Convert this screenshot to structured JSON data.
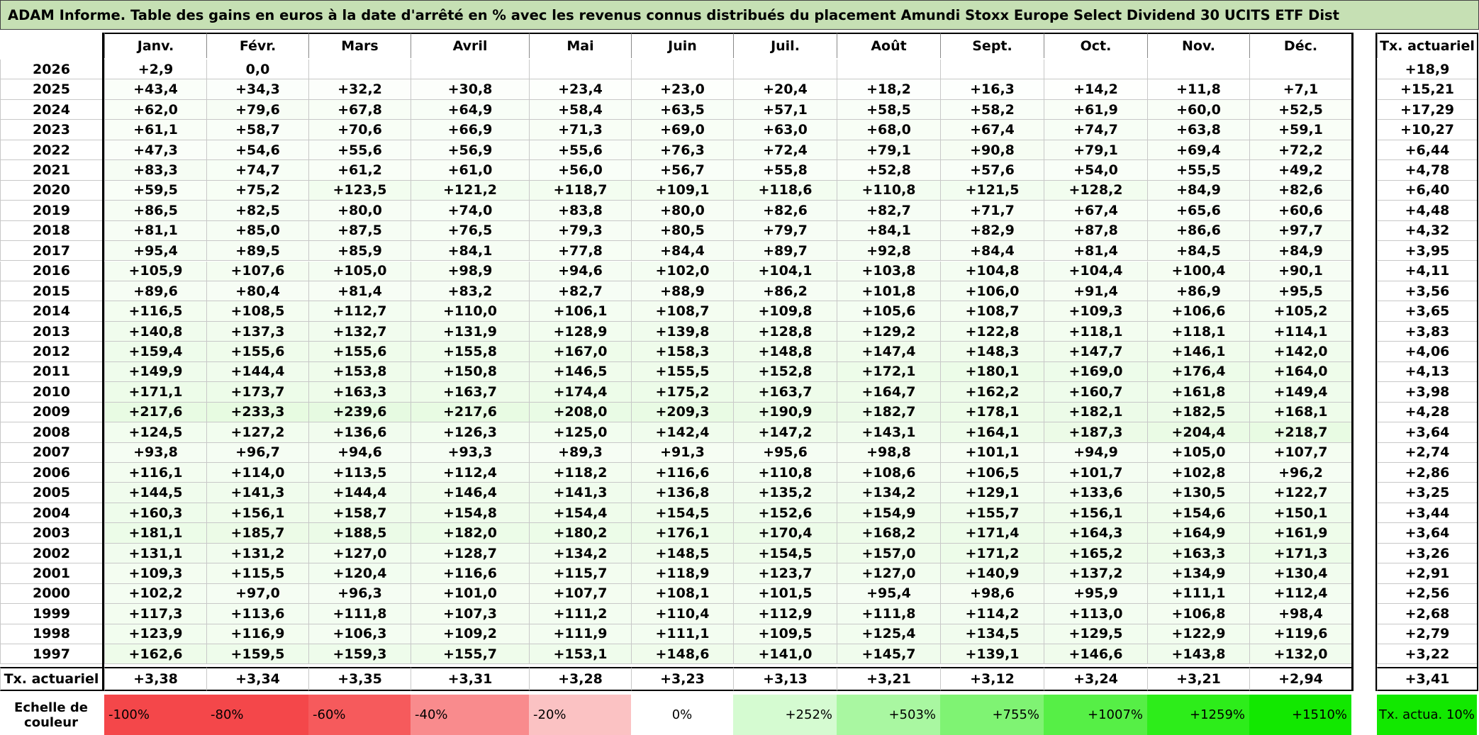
{
  "title": "ADAM Informe. Table des gains en euros à la date d'arrêté en % avec les revenus connus distribués du placement Amundi Stoxx Europe Select Dividend 30 UCITS ETF Dist",
  "months": [
    "Janv.",
    "Févr.",
    "Mars",
    "Avril",
    "Mai",
    "Juin",
    "Juil.",
    "Août",
    "Sept.",
    "Oct.",
    "Nov.",
    "Déc."
  ],
  "actuarial_header": "Tx. actuariel",
  "rows": [
    {
      "year": "2026",
      "values": [
        "+2,9",
        "0,0",
        "",
        "",
        "",
        "",
        "",
        "",
        "",
        "",
        "",
        ""
      ],
      "rate": "+18,9"
    },
    {
      "year": "2025",
      "values": [
        "+43,4",
        "+34,3",
        "+32,2",
        "+30,8",
        "+23,4",
        "+23,0",
        "+20,4",
        "+18,2",
        "+16,3",
        "+14,2",
        "+11,8",
        "+7,1"
      ],
      "rate": "+15,21"
    },
    {
      "year": "2024",
      "values": [
        "+62,0",
        "+79,6",
        "+67,8",
        "+64,9",
        "+58,4",
        "+63,5",
        "+57,1",
        "+58,5",
        "+58,2",
        "+61,9",
        "+60,0",
        "+52,5"
      ],
      "rate": "+17,29"
    },
    {
      "year": "2023",
      "values": [
        "+61,1",
        "+58,7",
        "+70,6",
        "+66,9",
        "+71,3",
        "+69,0",
        "+63,0",
        "+68,0",
        "+67,4",
        "+74,7",
        "+63,8",
        "+59,1"
      ],
      "rate": "+10,27"
    },
    {
      "year": "2022",
      "values": [
        "+47,3",
        "+54,6",
        "+55,6",
        "+56,9",
        "+55,6",
        "+76,3",
        "+72,4",
        "+79,1",
        "+90,8",
        "+79,1",
        "+69,4",
        "+72,2"
      ],
      "rate": "+6,44"
    },
    {
      "year": "2021",
      "values": [
        "+83,3",
        "+74,7",
        "+61,2",
        "+61,0",
        "+56,0",
        "+56,7",
        "+55,8",
        "+52,8",
        "+57,6",
        "+54,0",
        "+55,5",
        "+49,2"
      ],
      "rate": "+4,78"
    },
    {
      "year": "2020",
      "values": [
        "+59,5",
        "+75,2",
        "+123,5",
        "+121,2",
        "+118,7",
        "+109,1",
        "+118,6",
        "+110,8",
        "+121,5",
        "+128,2",
        "+84,9",
        "+82,6"
      ],
      "rate": "+6,40"
    },
    {
      "year": "2019",
      "values": [
        "+86,5",
        "+82,5",
        "+80,0",
        "+74,0",
        "+83,8",
        "+80,0",
        "+82,6",
        "+82,7",
        "+71,7",
        "+67,4",
        "+65,6",
        "+60,6"
      ],
      "rate": "+4,48"
    },
    {
      "year": "2018",
      "values": [
        "+81,1",
        "+85,0",
        "+87,5",
        "+76,5",
        "+79,3",
        "+80,5",
        "+79,7",
        "+84,1",
        "+82,9",
        "+87,8",
        "+86,6",
        "+97,7"
      ],
      "rate": "+4,32"
    },
    {
      "year": "2017",
      "values": [
        "+95,4",
        "+89,5",
        "+85,9",
        "+84,1",
        "+77,8",
        "+84,4",
        "+89,7",
        "+92,8",
        "+84,4",
        "+81,4",
        "+84,5",
        "+84,9"
      ],
      "rate": "+3,95"
    },
    {
      "year": "2016",
      "values": [
        "+105,9",
        "+107,6",
        "+105,0",
        "+98,9",
        "+94,6",
        "+102,0",
        "+104,1",
        "+103,8",
        "+104,8",
        "+104,4",
        "+100,4",
        "+90,1"
      ],
      "rate": "+4,11"
    },
    {
      "year": "2015",
      "values": [
        "+89,6",
        "+80,4",
        "+81,4",
        "+83,2",
        "+82,7",
        "+88,9",
        "+86,2",
        "+101,8",
        "+106,0",
        "+91,4",
        "+86,9",
        "+95,5"
      ],
      "rate": "+3,56"
    },
    {
      "year": "2014",
      "values": [
        "+116,5",
        "+108,5",
        "+112,7",
        "+110,0",
        "+106,1",
        "+108,7",
        "+109,8",
        "+105,6",
        "+108,7",
        "+109,3",
        "+106,6",
        "+105,2"
      ],
      "rate": "+3,65"
    },
    {
      "year": "2013",
      "values": [
        "+140,8",
        "+137,3",
        "+132,7",
        "+131,9",
        "+128,9",
        "+139,8",
        "+128,8",
        "+129,2",
        "+122,8",
        "+118,1",
        "+118,1",
        "+114,1"
      ],
      "rate": "+3,83"
    },
    {
      "year": "2012",
      "values": [
        "+159,4",
        "+155,6",
        "+155,6",
        "+155,8",
        "+167,0",
        "+158,3",
        "+148,8",
        "+147,4",
        "+148,3",
        "+147,7",
        "+146,1",
        "+142,0"
      ],
      "rate": "+4,06"
    },
    {
      "year": "2011",
      "values": [
        "+149,9",
        "+144,4",
        "+153,8",
        "+150,8",
        "+146,5",
        "+155,5",
        "+152,8",
        "+172,1",
        "+180,1",
        "+169,0",
        "+176,4",
        "+164,0"
      ],
      "rate": "+4,13"
    },
    {
      "year": "2010",
      "values": [
        "+171,1",
        "+173,7",
        "+163,3",
        "+163,7",
        "+174,4",
        "+175,2",
        "+163,7",
        "+164,7",
        "+162,2",
        "+160,7",
        "+161,8",
        "+149,4"
      ],
      "rate": "+3,98"
    },
    {
      "year": "2009",
      "values": [
        "+217,6",
        "+233,3",
        "+239,6",
        "+217,6",
        "+208,0",
        "+209,3",
        "+190,9",
        "+182,7",
        "+178,1",
        "+182,1",
        "+182,5",
        "+168,1"
      ],
      "rate": "+4,28"
    },
    {
      "year": "2008",
      "values": [
        "+124,5",
        "+127,2",
        "+136,6",
        "+126,3",
        "+125,0",
        "+142,4",
        "+147,2",
        "+143,1",
        "+164,1",
        "+187,3",
        "+204,4",
        "+218,7"
      ],
      "rate": "+3,64"
    },
    {
      "year": "2007",
      "values": [
        "+93,8",
        "+96,7",
        "+94,6",
        "+93,3",
        "+89,3",
        "+91,3",
        "+95,6",
        "+98,8",
        "+101,1",
        "+94,9",
        "+105,0",
        "+107,7"
      ],
      "rate": "+2,74"
    },
    {
      "year": "2006",
      "values": [
        "+116,1",
        "+114,0",
        "+113,5",
        "+112,4",
        "+118,2",
        "+116,6",
        "+110,8",
        "+108,6",
        "+106,5",
        "+101,7",
        "+102,8",
        "+96,2"
      ],
      "rate": "+2,86"
    },
    {
      "year": "2005",
      "values": [
        "+144,5",
        "+141,3",
        "+144,4",
        "+146,4",
        "+141,3",
        "+136,8",
        "+135,2",
        "+134,2",
        "+129,1",
        "+133,6",
        "+130,5",
        "+122,7"
      ],
      "rate": "+3,25"
    },
    {
      "year": "2004",
      "values": [
        "+160,3",
        "+156,1",
        "+158,7",
        "+154,8",
        "+154,4",
        "+154,5",
        "+152,6",
        "+154,9",
        "+155,7",
        "+156,1",
        "+154,6",
        "+150,1"
      ],
      "rate": "+3,44"
    },
    {
      "year": "2003",
      "values": [
        "+181,1",
        "+185,7",
        "+188,5",
        "+182,0",
        "+180,2",
        "+176,1",
        "+170,4",
        "+168,2",
        "+171,4",
        "+164,3",
        "+164,9",
        "+161,9"
      ],
      "rate": "+3,64"
    },
    {
      "year": "2002",
      "values": [
        "+131,1",
        "+131,2",
        "+127,0",
        "+128,7",
        "+134,2",
        "+148,5",
        "+154,5",
        "+157,0",
        "+171,2",
        "+165,2",
        "+163,3",
        "+171,3"
      ],
      "rate": "+3,26"
    },
    {
      "year": "2001",
      "values": [
        "+109,3",
        "+115,5",
        "+120,4",
        "+116,6",
        "+115,7",
        "+118,9",
        "+123,7",
        "+127,0",
        "+140,9",
        "+137,2",
        "+134,9",
        "+130,4"
      ],
      "rate": "+2,91"
    },
    {
      "year": "2000",
      "values": [
        "+102,2",
        "+97,0",
        "+96,3",
        "+101,0",
        "+107,7",
        "+108,1",
        "+101,5",
        "+95,4",
        "+98,6",
        "+95,9",
        "+111,1",
        "+112,4"
      ],
      "rate": "+2,56"
    },
    {
      "year": "1999",
      "values": [
        "+117,3",
        "+113,6",
        "+111,8",
        "+107,3",
        "+111,2",
        "+110,4",
        "+112,9",
        "+111,8",
        "+114,2",
        "+113,0",
        "+106,8",
        "+98,4"
      ],
      "rate": "+2,68"
    },
    {
      "year": "1998",
      "values": [
        "+123,9",
        "+116,9",
        "+106,3",
        "+109,2",
        "+111,9",
        "+111,1",
        "+109,5",
        "+125,4",
        "+134,5",
        "+129,5",
        "+122,9",
        "+119,6"
      ],
      "rate": "+2,79"
    },
    {
      "year": "1997",
      "values": [
        "+162,6",
        "+159,5",
        "+159,3",
        "+155,7",
        "+153,1",
        "+148,6",
        "+141,0",
        "+145,7",
        "+139,1",
        "+146,6",
        "+143,8",
        "+132,0"
      ],
      "rate": "+3,22"
    }
  ],
  "footer": {
    "label": "Tx. actuariel",
    "values": [
      "+3,38",
      "+3,34",
      "+3,35",
      "+3,31",
      "+3,28",
      "+3,23",
      "+3,13",
      "+3,21",
      "+3,12",
      "+3,24",
      "+3,21",
      "+2,94"
    ],
    "rate": "+3,41"
  },
  "scale": {
    "label": "Echelle de couleur",
    "items": [
      {
        "text": "-100%",
        "color": "#f4474a"
      },
      {
        "text": "-80%",
        "color": "#f4474a"
      },
      {
        "text": "-60%",
        "color": "#f65a5c"
      },
      {
        "text": "-40%",
        "color": "#f98b8d"
      },
      {
        "text": "-20%",
        "color": "#fbc2c3"
      },
      {
        "text": "0%",
        "color": "#ffffff"
      },
      {
        "text": "+252%",
        "color": "#d5fbd1"
      },
      {
        "text": "+503%",
        "color": "#a9f7a1"
      },
      {
        "text": "+755%",
        "color": "#7ff373"
      },
      {
        "text": "+1007%",
        "color": "#56ef46"
      },
      {
        "text": "+1259%",
        "color": "#2ded1a"
      },
      {
        "text": "+1510%",
        "color": "#12e800"
      }
    ],
    "rate_label": "Tx. actua. 10%",
    "rate_color": "#12e800"
  },
  "colors": {
    "title_bg": "#c6e0b4",
    "cell_green_light": "#f4fdf2",
    "cell_green_mid": "#ebfbe7"
  }
}
